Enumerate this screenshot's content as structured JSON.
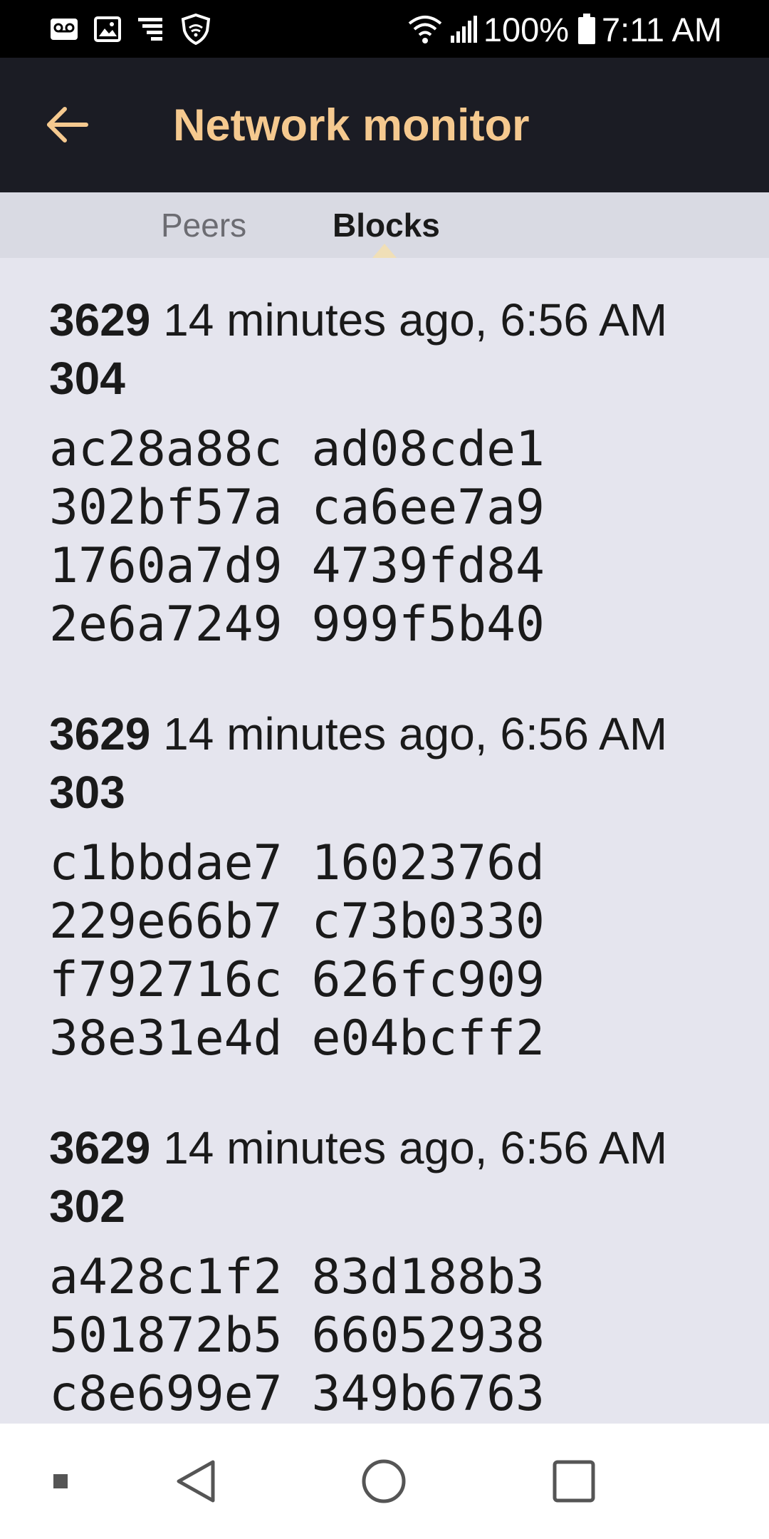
{
  "status_bar": {
    "left_icons": [
      "voicemail-icon",
      "image-icon",
      "network-speed-icon",
      "shield-icon"
    ],
    "right_icons": [
      "wifi-icon",
      "cell-signal-icon",
      "battery-icon"
    ],
    "battery_percent": "100%",
    "time": "7:11 AM"
  },
  "app_bar": {
    "back_icon": "arrow-left-icon",
    "title": "Network monitor",
    "title_color": "#f5c98f",
    "background": "#1b1c24"
  },
  "tabs": {
    "items": [
      {
        "label": "Peers",
        "selected": false
      },
      {
        "label": "Blocks",
        "selected": true
      }
    ]
  },
  "blocks": [
    {
      "height": "3629",
      "time": "14 minutes ago, 6:56 AM",
      "number": "304",
      "hash_lines": [
        "ac28a88c ad08cde1",
        "302bf57a ca6ee7a9",
        "1760a7d9 4739fd84",
        "2e6a7249 999f5b40"
      ]
    },
    {
      "height": "3629",
      "time": "14 minutes ago, 6:56 AM",
      "number": "303",
      "hash_lines": [
        "c1bbdae7 1602376d",
        "229e66b7 c73b0330",
        "f792716c 626fc909",
        "38e31e4d e04bcff2"
      ]
    },
    {
      "height": "3629",
      "time": "14 minutes ago, 6:56 AM",
      "number": "302",
      "hash_lines": [
        "a428c1f2 83d188b3",
        "501872b5 66052938",
        "c8e699e7 349b6763"
      ]
    }
  ],
  "nav_bar": {
    "buttons": [
      "square-dot-icon",
      "back-triangle-icon",
      "home-circle-icon",
      "recents-square-icon"
    ]
  }
}
